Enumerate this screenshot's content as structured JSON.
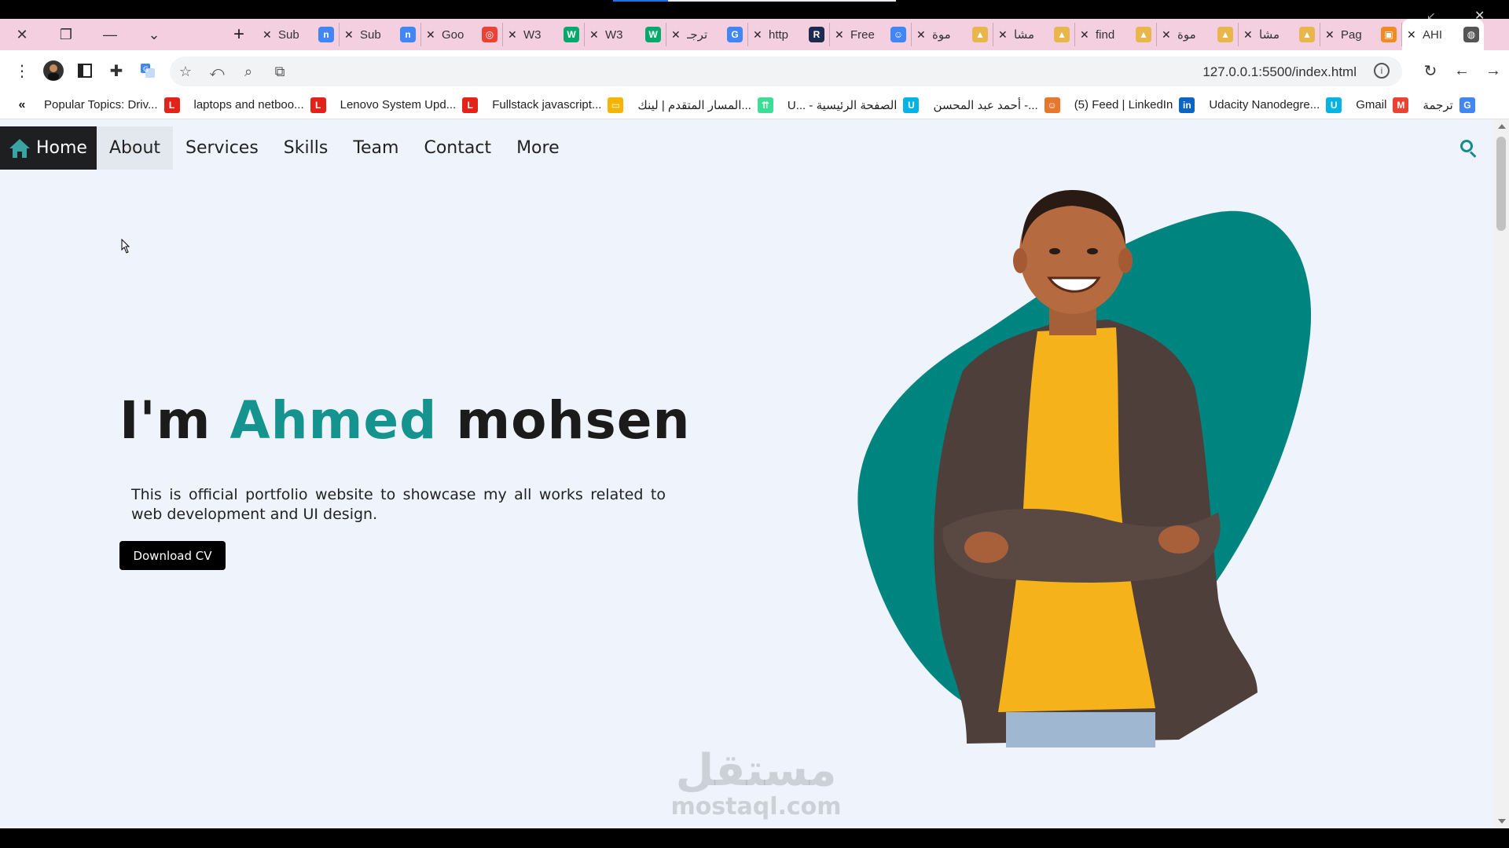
{
  "browser": {
    "tabs": [
      {
        "label": "Sub",
        "icon": "n",
        "color": "#4285f4"
      },
      {
        "label": "Sub",
        "icon": "n",
        "color": "#4285f4"
      },
      {
        "label": "Goo",
        "icon": "lens",
        "color": "#ea4335"
      },
      {
        "label": "W3",
        "icon": "w",
        "color": "#04aa6d"
      },
      {
        "label": "W3",
        "icon": "w",
        "color": "#04aa6d"
      },
      {
        "label": "ترجـ",
        "icon": "translate",
        "color": "#4285f4"
      },
      {
        "label": "http",
        "icon": "R",
        "color": "#1d2b4f"
      },
      {
        "label": "Free",
        "icon": "bot",
        "color": "#4285f4"
      },
      {
        "label": "موة",
        "icon": "mt",
        "color": "#e8b64a"
      },
      {
        "label": "مشا",
        "icon": "mt",
        "color": "#e8b64a"
      },
      {
        "label": "find",
        "icon": "mt",
        "color": "#e8b64a"
      },
      {
        "label": "موة",
        "icon": "mt",
        "color": "#e8b64a"
      },
      {
        "label": "مشا",
        "icon": "mt",
        "color": "#e8b64a"
      },
      {
        "label": "Pag",
        "icon": "page",
        "color": "#f08a24"
      },
      {
        "label": "AHI",
        "icon": "globe",
        "color": "#555555"
      }
    ],
    "url": "127.0.0.1:5500/index.html",
    "bookmarks": [
      {
        "label": "Popular Topics: Driv...",
        "icon": "L",
        "color": "#e2231a"
      },
      {
        "label": "laptops and netboo...",
        "icon": "L",
        "color": "#e2231a"
      },
      {
        "label": "Lenovo System Upd...",
        "icon": "L",
        "color": "#e2231a"
      },
      {
        "label": "Fullstack javascript...",
        "icon": "slides",
        "color": "#f4b400"
      },
      {
        "label": "المسار المتقدم | لينك...",
        "icon": "arrows",
        "color": "#3ddc97"
      },
      {
        "label": "U... - الصفحة الرئيسية",
        "icon": "U",
        "color": "#02b3e4"
      },
      {
        "label": "أحمد عبد المحسن -...",
        "icon": "face",
        "color": "#e8772e"
      },
      {
        "label": "(5) Feed | LinkedIn",
        "icon": "in",
        "color": "#0a66c2"
      },
      {
        "label": "Udacity Nanodegre...",
        "icon": "U",
        "color": "#02b3e4"
      },
      {
        "label": "Gmail",
        "icon": "M",
        "color": "#ea4335"
      },
      {
        "label": "ترجمة",
        "icon": "translate",
        "color": "#4285f4"
      }
    ]
  },
  "site": {
    "nav": {
      "home": "Home",
      "about": "About",
      "services": "Services",
      "skills": "Skills",
      "team": "Team",
      "contact": "Contact",
      "more": "More"
    },
    "hero": {
      "title_prefix": "I'm ",
      "title_accent": "Ahmed",
      "title_suffix": " mohsen",
      "description": "This is official portfolio website to showcase my all works related to web development and UI design.",
      "cv_button": "Download CV"
    },
    "colors": {
      "accent": "#15938f",
      "blob": "#00847f",
      "page_bg": "#eef3fc"
    }
  },
  "watermark": {
    "arabic": "مستقل",
    "latin": "mostaql.com"
  }
}
